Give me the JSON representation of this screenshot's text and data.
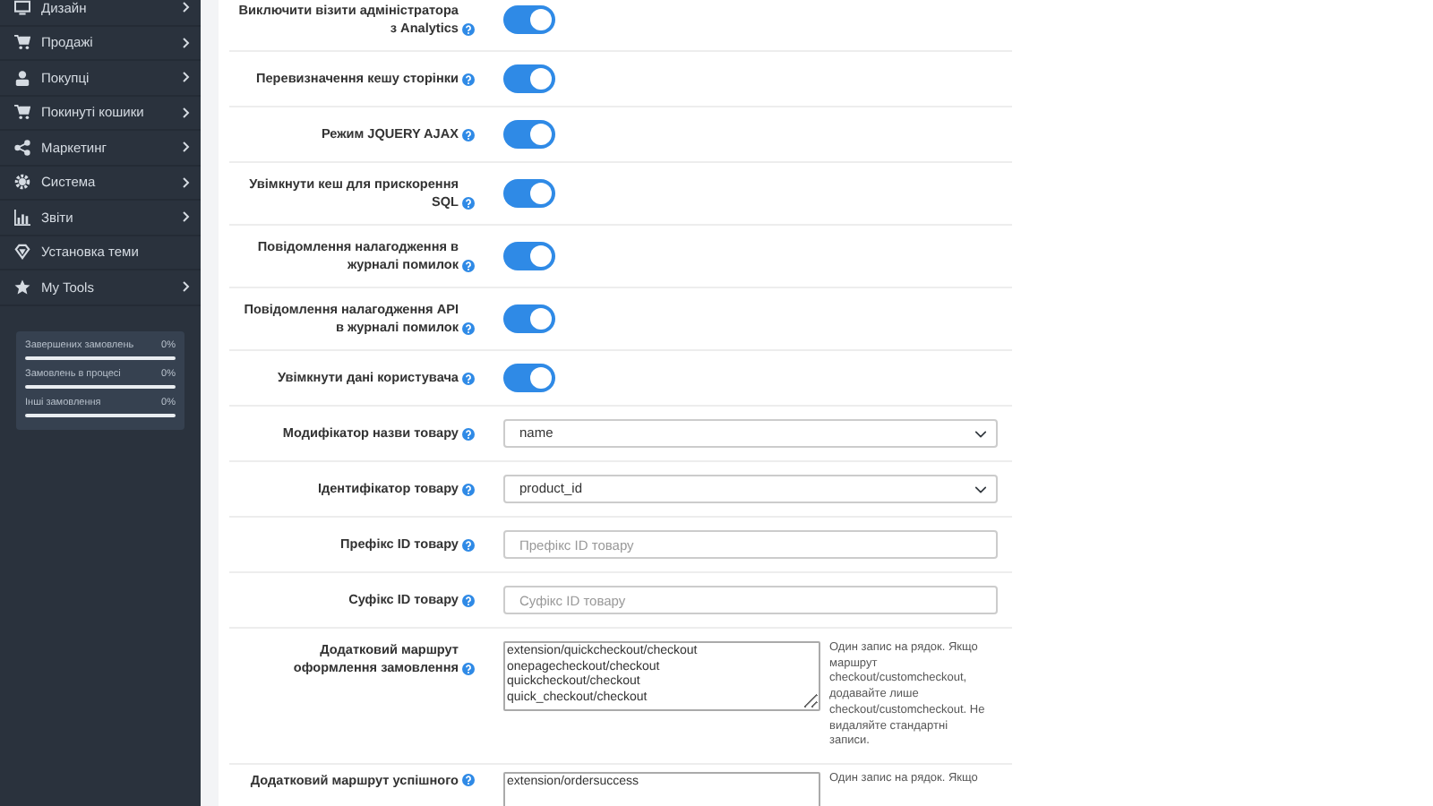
{
  "sidebar": {
    "items": [
      {
        "label": "Дизайн",
        "submenu": true
      },
      {
        "label": "Продажі",
        "submenu": true
      },
      {
        "label": "Покупці",
        "submenu": true
      },
      {
        "label": "Покинуті кошики",
        "submenu": true
      },
      {
        "label": "Маркетинг",
        "submenu": true
      },
      {
        "label": "Система",
        "submenu": true
      },
      {
        "label": "Звіти",
        "submenu": true
      },
      {
        "label": "Установка теми",
        "submenu": false
      },
      {
        "label": "My Tools",
        "submenu": true
      }
    ],
    "stats": [
      {
        "label": "Завершених замовлень",
        "value": "0%",
        "level": 0
      },
      {
        "label": "Замовлень в процесі",
        "value": "0%",
        "level": 0
      },
      {
        "label": "Інші замовлення",
        "value": "0%",
        "level": 0
      }
    ]
  },
  "settings": [
    {
      "kind": "toggle",
      "label": "Виключити візити адміністратора з Analytics",
      "on": true
    },
    {
      "kind": "toggle",
      "label": "Перевизначення кешу сторінки",
      "on": true
    },
    {
      "kind": "toggle",
      "label": "Режим JQUERY AJAX",
      "on": true
    },
    {
      "kind": "toggle",
      "label": "Увімкнути кеш для прискорення SQL",
      "on": true
    },
    {
      "kind": "toggle",
      "label": "Повідомлення налагодження в журналі помилок",
      "on": true
    },
    {
      "kind": "toggle",
      "label": "Повідомлення налагодження API в журналі помилок",
      "on": true
    },
    {
      "kind": "toggle",
      "label": "Увімкнути дані користувача",
      "on": true
    },
    {
      "kind": "select",
      "label": "Модифікатор назви товару",
      "value": "name"
    },
    {
      "kind": "select",
      "label": "Ідентифікатор товару",
      "value": "product_id"
    },
    {
      "kind": "input",
      "label": "Префікс ID товару",
      "placeholder": "Префікс ID товару"
    },
    {
      "kind": "input",
      "label": "Суфікс ID товару",
      "placeholder": "Суфікс ID товару"
    },
    {
      "kind": "textarea",
      "label": "Додатковий маршрут оформлення замовлення",
      "value": "extension/quickcheckout/checkout\nonepagecheckout/checkout\nquickcheckout/checkout\nquick_checkout/checkout",
      "note": "Один запис на рядок. Якщо маршрут checkout/customcheckout, додавайте лише checkout/customcheckout. Не видаляйте стандартні записи."
    },
    {
      "kind": "textarea",
      "label": "Додатковий маршрут успішного",
      "value": "extension/ordersuccess",
      "note": "Один запис на рядок. Якщо"
    }
  ]
}
